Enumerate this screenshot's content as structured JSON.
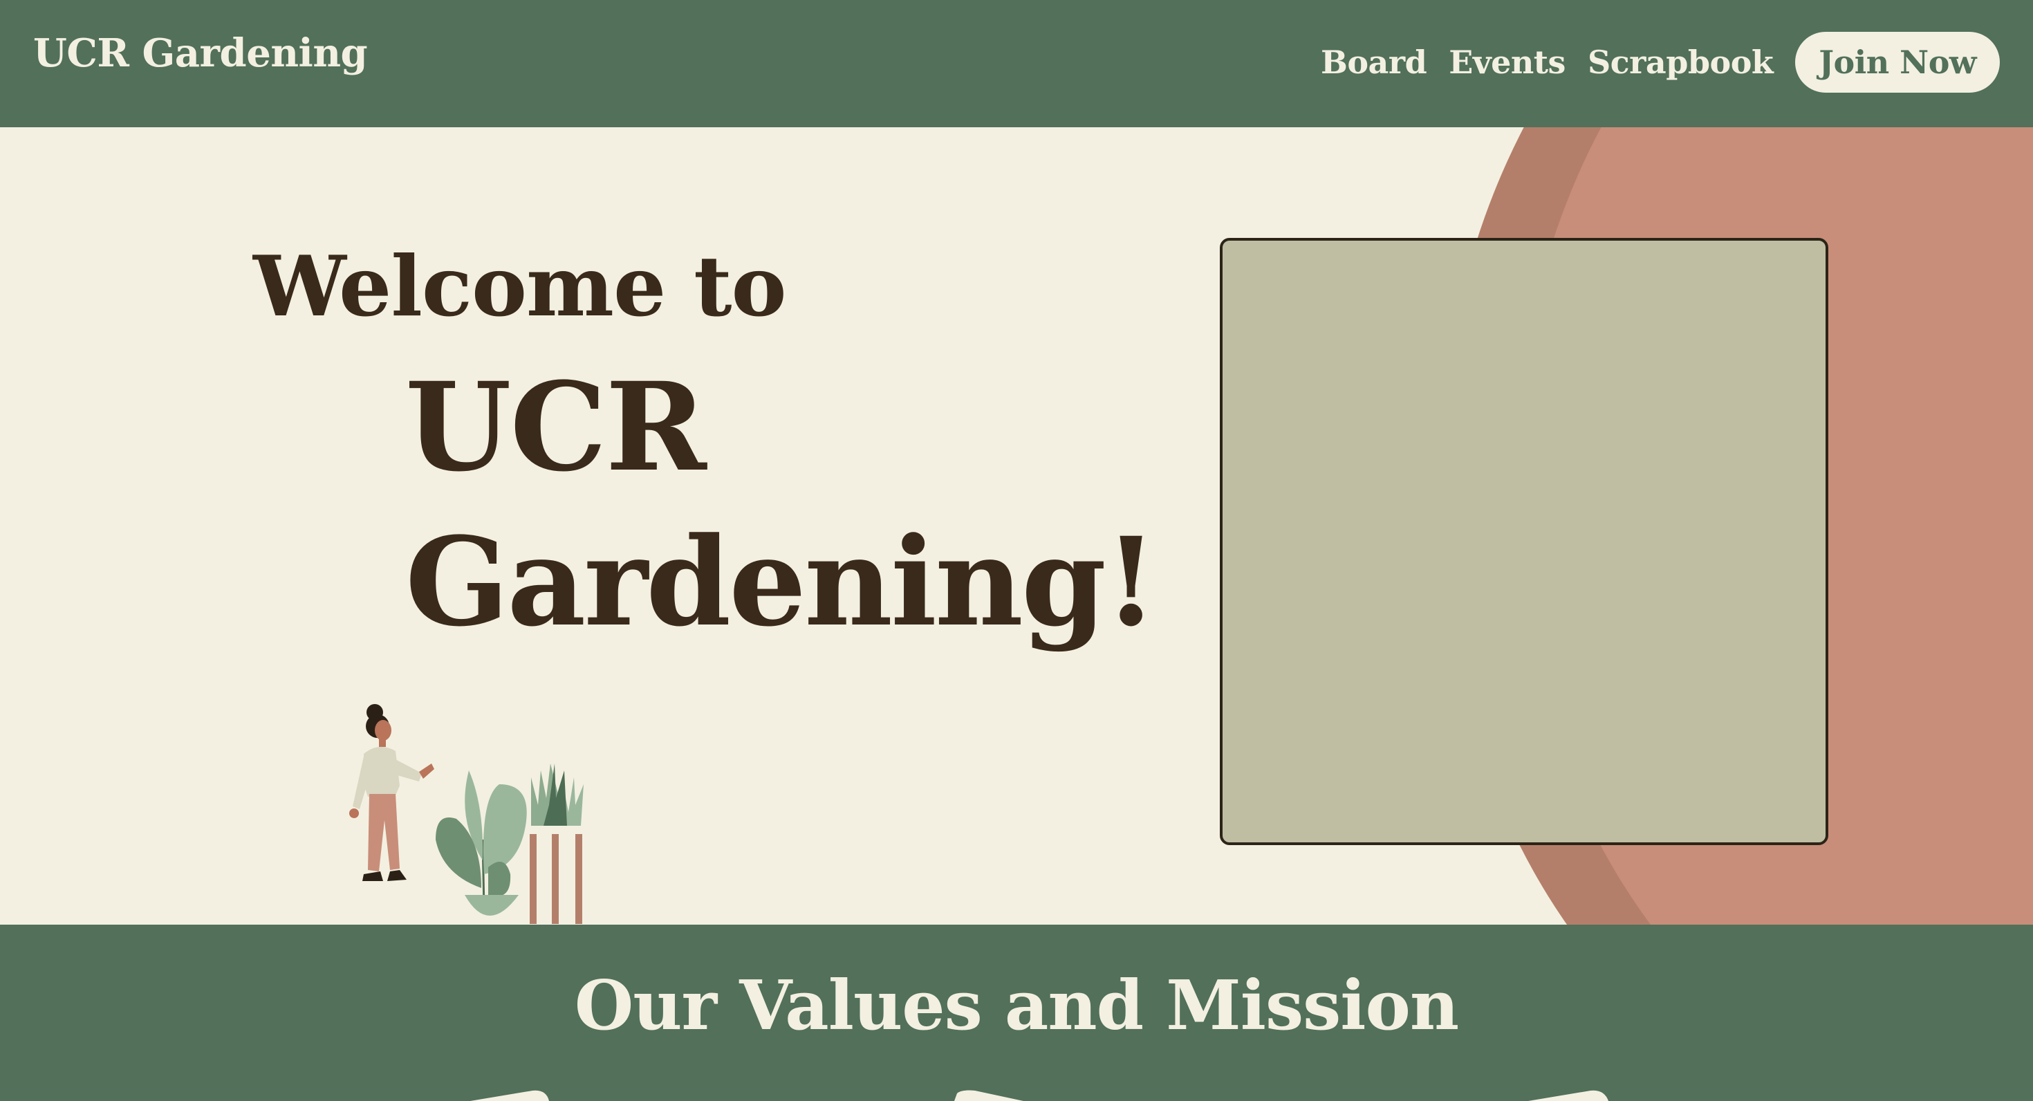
{
  "nav": {
    "brand": "UCR Gardening",
    "links": [
      "Board",
      "Events",
      "Scrapbook"
    ],
    "cta": "Join Now"
  },
  "hero": {
    "line1": "Welcome to",
    "line2": "UCR",
    "line3": "Gardening!"
  },
  "values": {
    "title": "Our Values and Mission"
  },
  "colors": {
    "primary_green": "#52705a",
    "cream": "#f3f0e1",
    "terracotta": "#c88e7a",
    "terracotta_dark": "#b47f6a",
    "sage_box": "#bfbea3",
    "text_dark": "#3a2a1b"
  },
  "icons": [
    "person-illustration",
    "leafy-plant-illustration",
    "snake-plant-illustration"
  ]
}
